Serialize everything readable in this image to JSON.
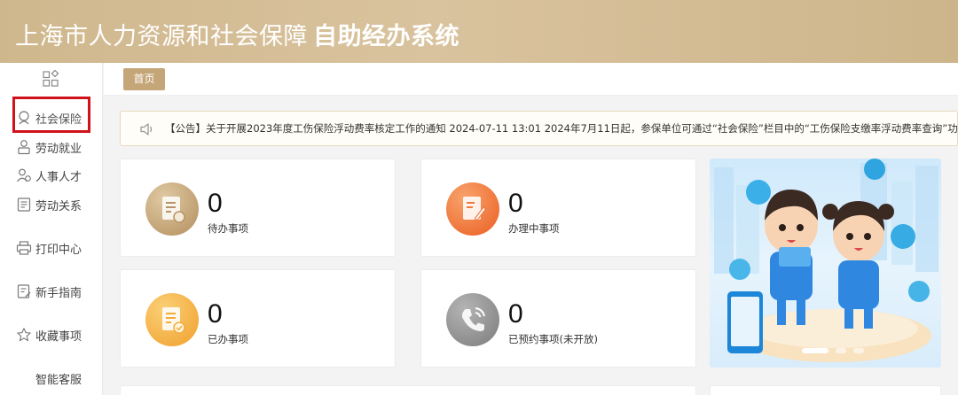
{
  "header": {
    "title": "上海市人力资源和社会保障",
    "subtitle": "自助经办系统"
  },
  "sidebar": {
    "items": [
      {
        "label": "社会保险",
        "icon": "social-insurance-icon"
      },
      {
        "label": "劳动就业",
        "icon": "employment-icon"
      },
      {
        "label": "人事人才",
        "icon": "talent-icon"
      },
      {
        "label": "劳动关系",
        "icon": "labor-relations-icon"
      },
      {
        "label": "打印中心",
        "icon": "printer-icon"
      },
      {
        "label": "新手指南",
        "icon": "guide-icon"
      },
      {
        "label": "收藏事项",
        "icon": "star-icon"
      },
      {
        "label": "智能客服",
        "icon": ""
      }
    ]
  },
  "tabs": {
    "home": "首页"
  },
  "notice": {
    "text": "【公告】关于开展2023年度工伤保险浮动费率核定工作的通知 2024-07-11 13:01 2024年7月11日起，参保单位可通过“社会保险”栏目中的“工伤保险支缴率浮动费率查询”功能查"
  },
  "stats": [
    {
      "count": "0",
      "label": "待办事项",
      "color": "#c9a97c"
    },
    {
      "count": "0",
      "label": "办理中事项",
      "color": "#f0773b"
    },
    {
      "count": "0",
      "label": "已办事项",
      "color": "#f5b447"
    },
    {
      "count": "0",
      "label": "已预约事项(未开放)",
      "color": "#8f8f8f"
    }
  ],
  "banner": {
    "slides": 3,
    "active_slide": 1
  },
  "colors": {
    "header_gold": "#d4bd93",
    "tab_gold": "#c5a678",
    "highlight_red": "#d0121b"
  }
}
